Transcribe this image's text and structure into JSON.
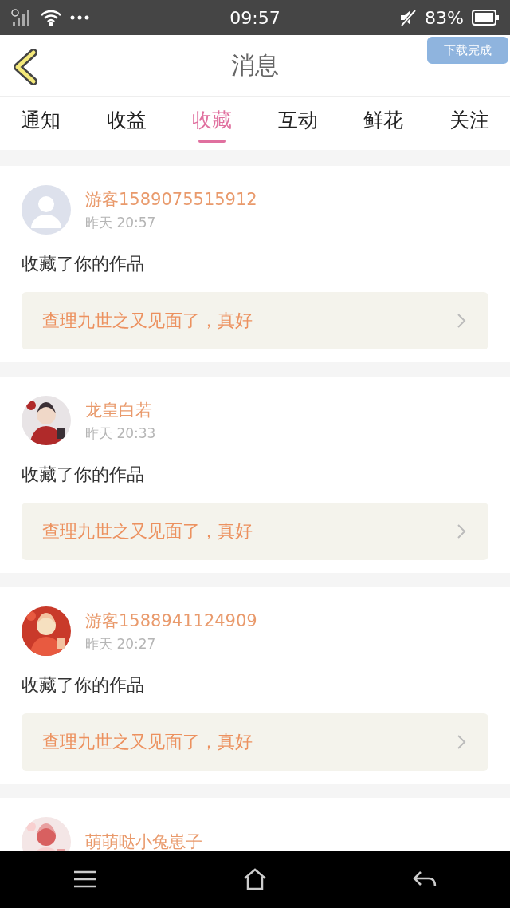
{
  "status_bar": {
    "time": "09:57",
    "battery": "83%"
  },
  "header": {
    "title": "消息",
    "toast": "下载完成"
  },
  "tabs": [
    {
      "label": "通知",
      "selected": false
    },
    {
      "label": "收益",
      "selected": false
    },
    {
      "label": "收藏",
      "selected": true
    },
    {
      "label": "互动",
      "selected": false
    },
    {
      "label": "鲜花",
      "selected": false
    },
    {
      "label": "关注",
      "selected": false
    }
  ],
  "messages": [
    {
      "avatar": {
        "kind": "default"
      },
      "user": "游客1589075515912",
      "time": "昨天 20:57",
      "action": "收藏了你的作品",
      "work": "查理九世之又见面了，真好"
    },
    {
      "user": "龙皇白若",
      "time": "昨天 20:33",
      "action": "收藏了你的作品",
      "work": "查理九世之又见面了，真好"
    },
    {
      "user": "游客1588941124909",
      "time": "昨天 20:27",
      "action": "收藏了你的作品",
      "work": "查理九世之又见面了，真好"
    },
    {
      "user": "萌萌哒小兔崽子"
    }
  ]
}
